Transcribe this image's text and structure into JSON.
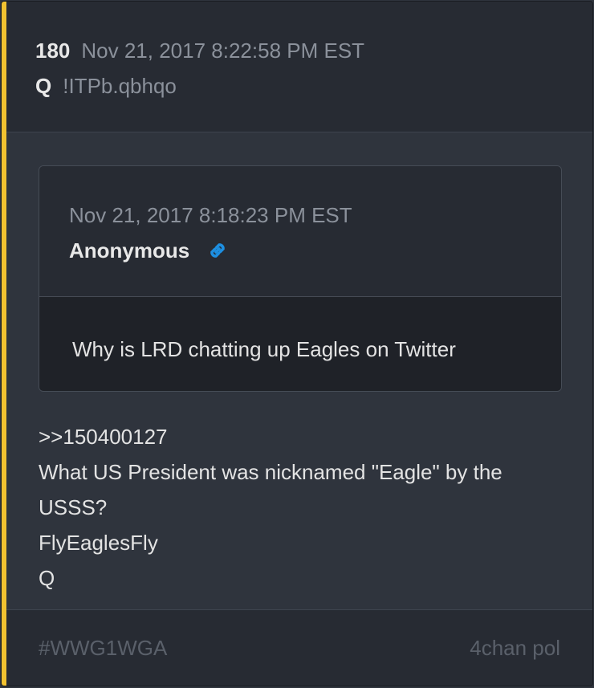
{
  "post": {
    "number": "180",
    "timestamp": "Nov 21, 2017 8:22:58 PM EST",
    "author": "Q",
    "tripcode": "!ITPb.qbhqo",
    "accent_color": "#f2c230"
  },
  "quoted_post": {
    "timestamp": "Nov 21, 2017 8:18:23 PM EST",
    "author": "Anonymous",
    "link_icon": "link-icon",
    "link_color": "#1d8fe1",
    "text": "Why is LRD chatting up Eagles on Twitter"
  },
  "body": {
    "lines": [
      ">>150400127",
      "What US President was nicknamed \"Eagle\" by the",
      "USSS?",
      "FlyEaglesFly",
      "Q"
    ]
  },
  "footer": {
    "tag": "#WWG1WGA",
    "source": "4chan pol"
  }
}
